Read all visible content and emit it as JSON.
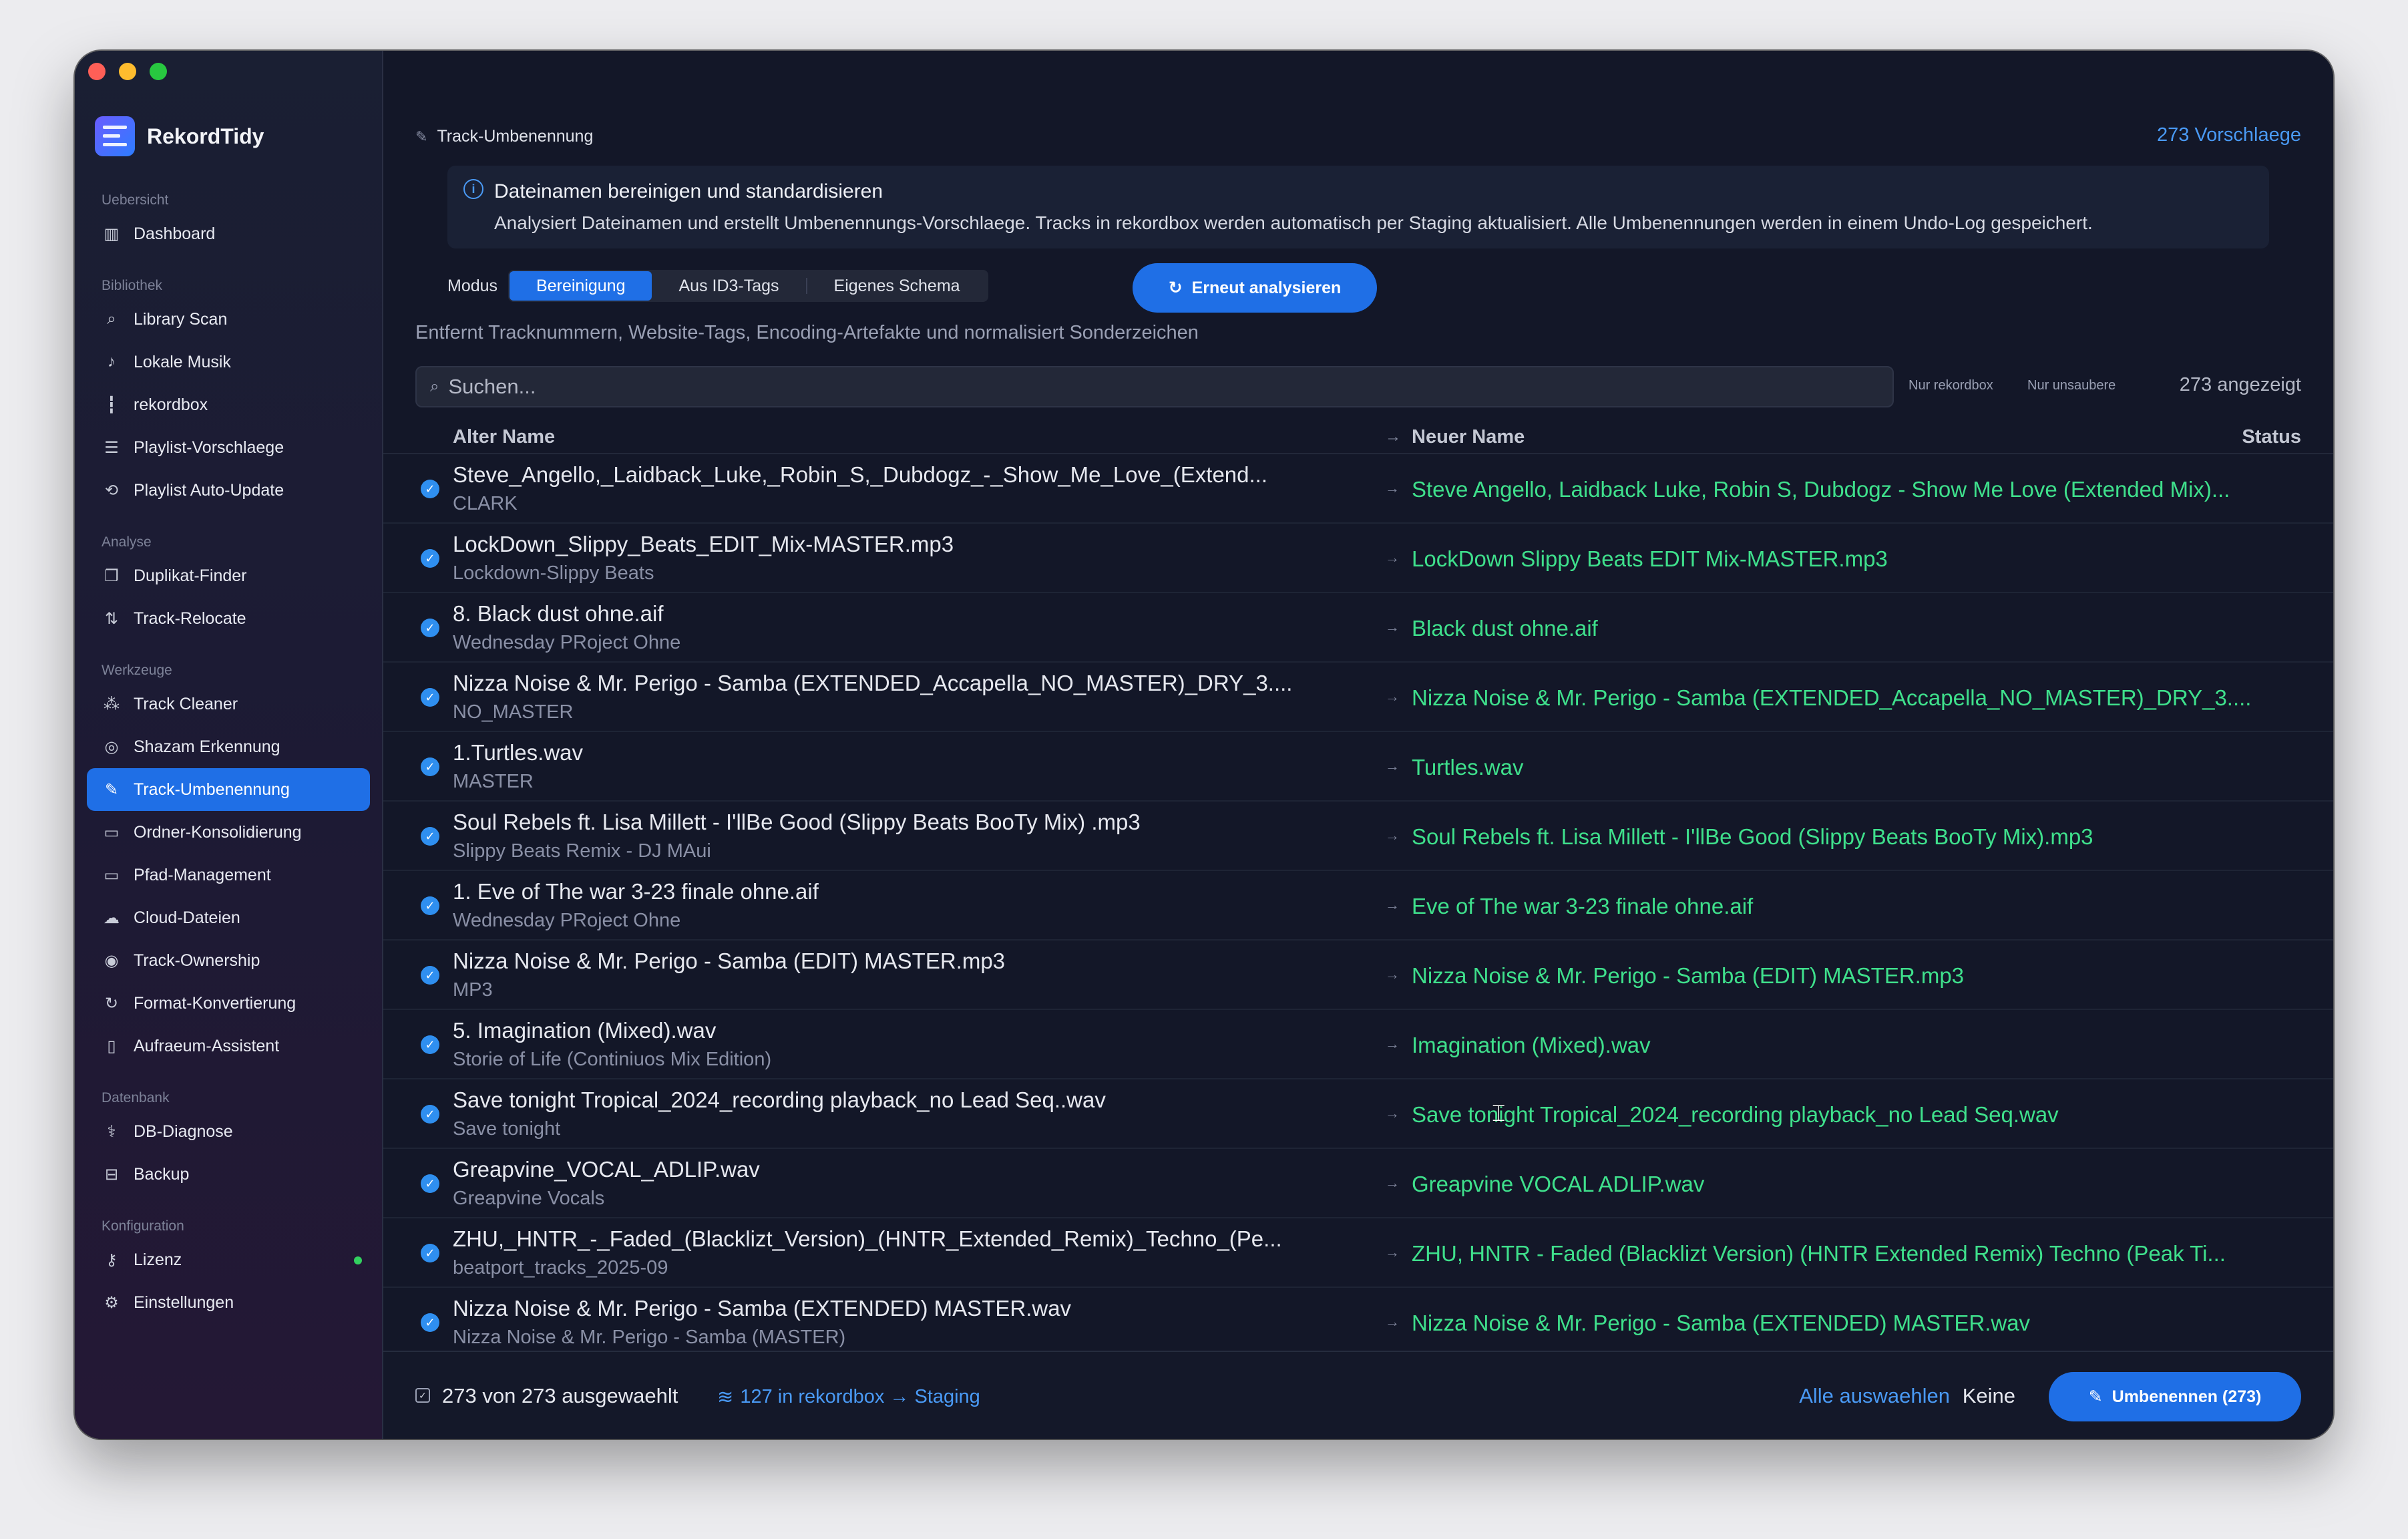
{
  "app": {
    "name": "RekordTidy"
  },
  "sidebar": {
    "sections": [
      {
        "title": "Uebersicht",
        "items": [
          {
            "label": "Dashboard",
            "icon": "bar-chart-icon"
          }
        ]
      },
      {
        "title": "Bibliothek",
        "items": [
          {
            "label": "Library Scan",
            "icon": "search-icon"
          },
          {
            "label": "Lokale Musik",
            "icon": "music-note-icon"
          },
          {
            "label": "rekordbox",
            "icon": "waveform-icon"
          },
          {
            "label": "Playlist-Vorschlaege",
            "icon": "playlist-add-icon"
          },
          {
            "label": "Playlist Auto-Update",
            "icon": "refresh-loop-icon"
          }
        ]
      },
      {
        "title": "Analyse",
        "items": [
          {
            "label": "Duplikat-Finder",
            "icon": "copy-icon"
          },
          {
            "label": "Track-Relocate",
            "icon": "swap-icon"
          }
        ]
      },
      {
        "title": "Werkzeuge",
        "items": [
          {
            "label": "Track Cleaner",
            "icon": "magic-wand-icon"
          },
          {
            "label": "Shazam Erkennung",
            "icon": "shazam-icon"
          },
          {
            "label": "Track-Umbenennung",
            "icon": "pencil-icon",
            "active": true
          },
          {
            "label": "Ordner-Konsolidierung",
            "icon": "folder-icon"
          },
          {
            "label": "Pfad-Management",
            "icon": "folder-path-icon"
          },
          {
            "label": "Cloud-Dateien",
            "icon": "cloud-icon"
          },
          {
            "label": "Track-Ownership",
            "icon": "user-icon"
          },
          {
            "label": "Format-Konvertierung",
            "icon": "convert-icon"
          },
          {
            "label": "Aufraeum-Assistent",
            "icon": "trash-icon"
          }
        ]
      },
      {
        "title": "Datenbank",
        "items": [
          {
            "label": "DB-Diagnose",
            "icon": "stethoscope-icon"
          },
          {
            "label": "Backup",
            "icon": "backup-icon"
          }
        ]
      },
      {
        "title": "Konfiguration",
        "items": [
          {
            "label": "Lizenz",
            "icon": "key-icon",
            "status_dot": "#32d15f"
          },
          {
            "label": "Einstellungen",
            "icon": "gear-icon"
          }
        ]
      }
    ]
  },
  "header": {
    "breadcrumb": "Track-Umbenennung",
    "suggestion_count": "273 Vorschlaege"
  },
  "info": {
    "title": "Dateinamen bereinigen und standardisieren",
    "text": "Analysiert Dateinamen und erstellt Umbenennungs-Vorschlaege. Tracks in rekordbox werden automatisch per Staging aktualisiert. Alle Umbenennungen werden in einem Undo-Log gespeichert."
  },
  "mode": {
    "label": "Modus",
    "options": [
      "Bereinigung",
      "Aus ID3-Tags",
      "Eigenes Schema"
    ],
    "selected": "Bereinigung",
    "reanalyze_label": "Erneut analysieren",
    "description": "Entfernt Tracknummern, Website-Tags, Encoding-Artefakte und normalisiert Sonderzeichen"
  },
  "search": {
    "placeholder": "Suchen...",
    "filter_rekordbox": "Nur rekordbox",
    "filter_unclean": "Nur unsaubere",
    "shown_count": "273 angezeigt"
  },
  "table": {
    "columns": {
      "old": "Alter Name",
      "new": "Neuer Name",
      "status": "Status"
    },
    "rows": [
      {
        "old": "Steve_Angello,_Laidback_Luke,_Robin_S,_Dubdogz_-_Show_Me_Love_(Extend...",
        "sub": "CLARK",
        "new": "Steve Angello, Laidback Luke, Robin S, Dubdogz - Show Me Love (Extended Mix)..."
      },
      {
        "old": "LockDown_Slippy_Beats_EDIT_Mix-MASTER.mp3",
        "sub": "Lockdown-Slippy Beats",
        "new": "LockDown Slippy Beats EDIT Mix-MASTER.mp3"
      },
      {
        "old": "8. Black dust ohne.aif",
        "sub": "Wednesday PRoject Ohne",
        "new": "Black dust ohne.aif"
      },
      {
        "old": "Nizza Noise  & Mr. Perigo - Samba (EXTENDED_Accapella_NO_MASTER)_DRY_3....",
        "sub": "NO_MASTER",
        "new": "Nizza Noise & Mr. Perigo - Samba (EXTENDED_Accapella_NO_MASTER)_DRY_3...."
      },
      {
        "old": "1.Turtles.wav",
        "sub": "MASTER",
        "new": "Turtles.wav"
      },
      {
        "old": "Soul Rebels ft. Lisa Millett - I'llBe Good (Slippy Beats BooTy Mix) .mp3",
        "sub": "Slippy Beats Remix  - DJ MAui",
        "new": "Soul Rebels ft. Lisa Millett - I'llBe Good (Slippy Beats BooTy Mix).mp3"
      },
      {
        "old": "1. Eve of The war 3-23 finale ohne.aif",
        "sub": "Wednesday PRoject Ohne",
        "new": "Eve of The war 3-23 finale ohne.aif"
      },
      {
        "old": "Nizza Noise  & Mr. Perigo - Samba (EDIT) MASTER.mp3",
        "sub": "MP3",
        "new": "Nizza Noise & Mr. Perigo - Samba (EDIT) MASTER.mp3"
      },
      {
        "old": "5. Imagination (Mixed).wav",
        "sub": "Storie of Life (Continiuos Mix Edition)",
        "new": "Imagination (Mixed).wav"
      },
      {
        "old": "Save tonight Tropical_2024_recording playback_no Lead Seq..wav",
        "sub": "Save tonight",
        "new": "Save tonight Tropical_2024_recording playback_no Lead Seq.wav"
      },
      {
        "old": "Greapvine_VOCAL_ADLIP.wav",
        "sub": "Greapvine Vocals",
        "new": "Greapvine VOCAL ADLIP.wav"
      },
      {
        "old": "ZHU,_HNTR_-_Faded_(Blacklizt_Version)_(HNTR_Extended_Remix)_Techno_(Pe...",
        "sub": "beatport_tracks_2025-09",
        "new": "ZHU, HNTR - Faded (Blacklizt Version) (HNTR Extended Remix) Techno (Peak Ti..."
      },
      {
        "old": "Nizza Noise  & Mr. Perigo - Samba (EXTENDED) MASTER.wav",
        "sub": "Nizza Noise  & Mr. Perigo - Samba (MASTER)",
        "new": "Nizza Noise & Mr. Perigo - Samba (EXTENDED) MASTER.wav"
      }
    ]
  },
  "footer": {
    "selected": "273 von 273 ausgewaehlt",
    "rekordbox_staging": "127 in rekordbox → Staging",
    "select_all": "Alle auswaehlen",
    "select_none": "Keine",
    "rename_button": "Umbenennen (273)"
  },
  "colors": {
    "accent": "#1f6fe6",
    "new_name": "#3fe08c",
    "link": "#4a9af5"
  }
}
